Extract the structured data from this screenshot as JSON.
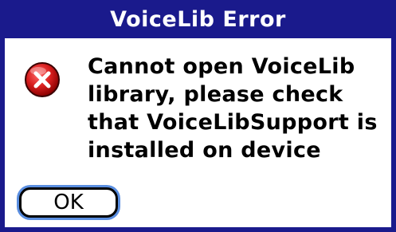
{
  "dialog": {
    "title": "VoiceLib Error",
    "icon": "error-x-icon",
    "message": "Cannot open VoiceLib library, please check that VoiceLibSupport is installed on device",
    "ok_label": "OK"
  },
  "colors": {
    "titlebar": "#1a1a8c",
    "border": "#1a1a8c",
    "icon_red": "#cc1a1a",
    "focus_ring": "#5a8ee0"
  }
}
